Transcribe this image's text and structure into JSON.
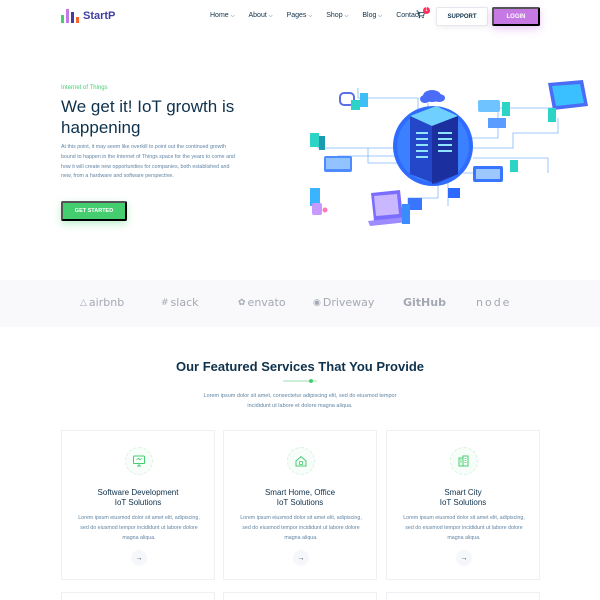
{
  "brand": {
    "name": "StartP",
    "bar_colors": [
      "#44ce6f",
      "#c679e3",
      "#3e3ea6",
      "#ff612f"
    ]
  },
  "nav": {
    "items": [
      {
        "label": "Home",
        "has_dropdown": true
      },
      {
        "label": "About",
        "has_dropdown": true
      },
      {
        "label": "Pages",
        "has_dropdown": true
      },
      {
        "label": "Shop",
        "has_dropdown": true
      },
      {
        "label": "Blog",
        "has_dropdown": true
      },
      {
        "label": "Contact",
        "has_dropdown": false
      }
    ],
    "cart_count": "1",
    "support_label": "SUPPORT",
    "login_label": "LOGIN"
  },
  "hero": {
    "subtitle": "Internet of Things",
    "title": "We get it! IoT growth is happening",
    "text": "At this point, it may seem like overkill to point out the continued growth bound to happen in the Internet of Things space for the years to come and how it will create new opportunities for companies, both established and new, from a hardware and software perspective.",
    "cta_label": "GET STARTED"
  },
  "partners": [
    {
      "name": "airbnb",
      "glyph": "airbnb-icon"
    },
    {
      "name": "slack",
      "glyph": "slack-icon"
    },
    {
      "name": "envato",
      "glyph": "envato-icon"
    },
    {
      "name": "Driveway",
      "glyph": "driveway-icon"
    },
    {
      "name": "GitHub",
      "glyph": ""
    },
    {
      "name": "node",
      "glyph": ""
    }
  ],
  "services": {
    "title": "Our Featured Services That You Provide",
    "text": "Lorem ipsum dolor sit amet, consectetur adipiscing elit, sed do eiusmod tempor incididunt ut labore et dolore magna aliqua.",
    "cards": [
      {
        "icon": "monitor-icon",
        "title_line1": "Software Development",
        "title_line2": "IoT Solutions",
        "text": "Lorem ipsum eiusmod dolor sit amet elit, adipiscing, sed do eiusmod tempor incididunt ut labore dolore magna aliqua."
      },
      {
        "icon": "smart-home-icon",
        "title_line1": "Smart Home, Office",
        "title_line2": "IoT Solutions",
        "text": "Lorem ipsum eiusmod dolor sit amet elit, adipiscing, sed do eiusmod tempor incididunt ut labore dolore magna aliqua."
      },
      {
        "icon": "city-buildings-icon",
        "title_line1": "Smart City",
        "title_line2": "IoT Solutions",
        "text": "Lorem ipsum eiusmod dolor sit amet elit, adipiscing, sed do eiusmod tempor incididunt ut labore dolore magna aliqua."
      }
    ]
  },
  "colors": {
    "accent_green": "#44ce6f",
    "accent_purple": "#c679e3",
    "heading": "#0e314c",
    "body_text": "#6084a4",
    "badge_red": "#ff2e5b"
  }
}
